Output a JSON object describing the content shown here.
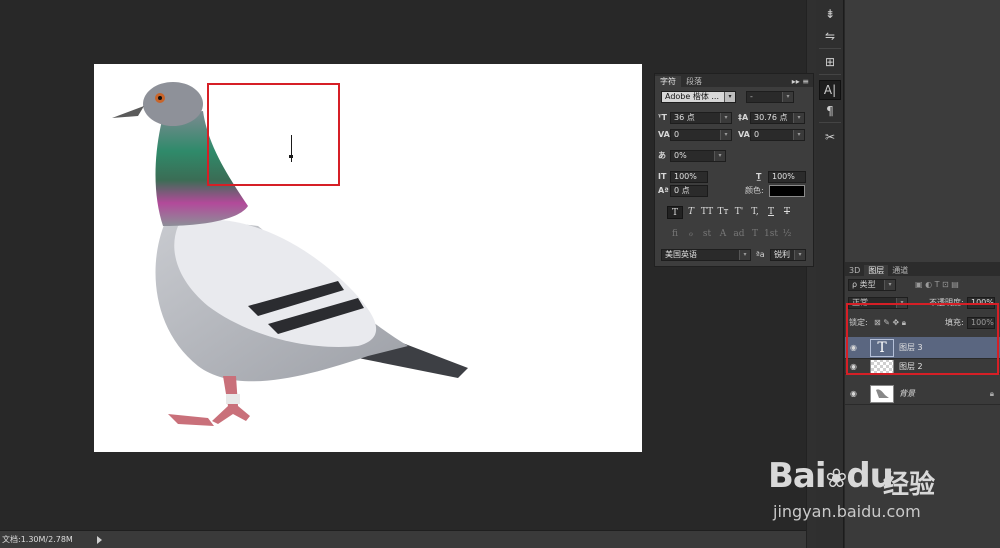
{
  "status_bar": {
    "doc_info": "文档:1.30M/2.78M",
    "menu_arrow": "play-triangle-icon"
  },
  "tools": [
    {
      "name": "brush-settings-icon",
      "glyph": "⇟",
      "active": false
    },
    {
      "name": "tool-presets-icon",
      "glyph": "⇋",
      "active": false
    },
    {
      "name": "clone-source-icon",
      "glyph": "⊞",
      "active": false
    },
    {
      "name": "character-panel-icon",
      "glyph": "A|",
      "active": true
    },
    {
      "name": "paragraph-panel-icon",
      "glyph": "¶",
      "active": false
    },
    {
      "name": "tools-icon",
      "glyph": "✂",
      "active": false
    }
  ],
  "character_panel": {
    "tabs": [
      "字符",
      "段落"
    ],
    "menu_glyph": "▸▸ ≡",
    "font_family": "Adobe 楷体 ...",
    "font_style": "-",
    "font_size": "36 点",
    "leading": "30.76 点",
    "kerning": "0",
    "tracking": "0",
    "tsume": "0%",
    "vertical_scale": "100%",
    "horizontal_scale": "100%",
    "baseline_shift": "0 点",
    "color_label": "颜色:",
    "color_value": "#000000",
    "style_buttons": [
      "T",
      "T",
      "TT",
      "Tт",
      "T'",
      "T,",
      "T",
      "T"
    ],
    "opentype_buttons": [
      "fi",
      "ℴ",
      "st",
      "A",
      "ad",
      "T",
      "1st",
      "½"
    ],
    "language": "美国英语",
    "aa_label": "ªa",
    "antialias": "锐利"
  },
  "layers_panel": {
    "tabs": [
      "3D",
      "图层",
      "通道"
    ],
    "filter": "ρ 类型",
    "blend_mode": "正常",
    "opacity_label": "不透明度:",
    "opacity": "100%",
    "lock_label": "锁定:",
    "fill_label": "填充:",
    "fill": "100%",
    "layers": [
      {
        "name": "图层 3",
        "type": "text",
        "selected": true,
        "visible": true
      },
      {
        "name": "图层 2",
        "type": "image",
        "selected": false,
        "visible": true
      },
      {
        "name": "背景",
        "type": "background",
        "selected": false,
        "visible": true,
        "locked": true
      }
    ]
  },
  "watermark": {
    "brand": "Bai",
    "brand2": "du",
    "cn": "经验",
    "url": "jingyan.baidu.com"
  },
  "colors": {
    "highlight_red": "#d61f26",
    "selected_layer": "#5a6680",
    "workspace": "#282828"
  }
}
